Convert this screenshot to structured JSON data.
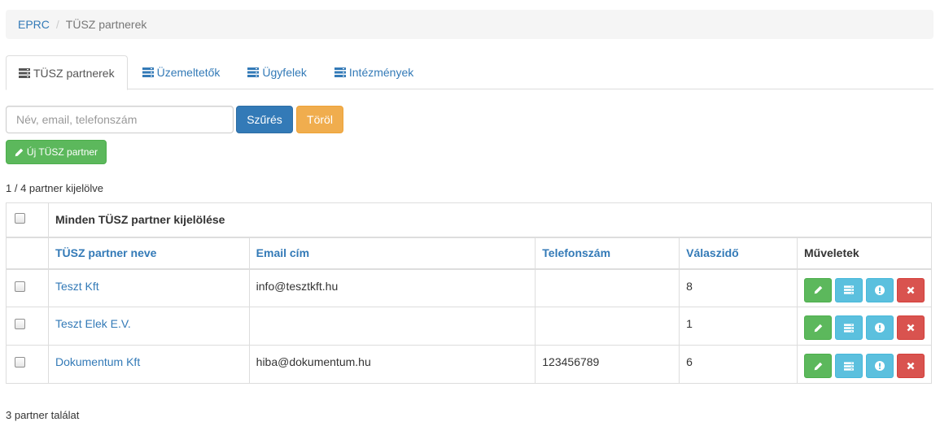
{
  "breadcrumb": {
    "root": "EPRC",
    "separator": "/",
    "current": "TÜSZ partnerek"
  },
  "tabs": [
    {
      "label": "TÜSZ partnerek",
      "icon": "list-icon",
      "active": true
    },
    {
      "label": "Üzemeltetők",
      "icon": "list-icon",
      "active": false
    },
    {
      "label": "Ügyfelek",
      "icon": "list-icon",
      "active": false
    },
    {
      "label": "Intézmények",
      "icon": "list-icon",
      "active": false
    }
  ],
  "filter": {
    "search_placeholder": "Név, email, telefonszám",
    "search_value": "",
    "filter_label": "Szűrés",
    "clear_label": "Töröl"
  },
  "new_button_label": "Új TÜSZ partner",
  "selected_count_text": "1 / 4 partner kijelölve",
  "select_all_label": "Minden TÜSZ partner kijelölése",
  "columns": {
    "name": "TÜSZ partner neve",
    "email": "Email cím",
    "phone": "Telefonszám",
    "response": "Válaszidő",
    "actions": "Műveletek"
  },
  "rows": [
    {
      "name": "Teszt Kft",
      "email": "info@tesztkft.hu",
      "phone": "",
      "response": "8"
    },
    {
      "name": "Teszt Elek E.V.",
      "email": "",
      "phone": "",
      "response": "1"
    },
    {
      "name": "Dokumentum Kft",
      "email": "hiba@dokumentum.hu",
      "phone": "123456789",
      "response": "6"
    }
  ],
  "results_count_text": "3 partner találat",
  "colors": {
    "primary": "#337ab7",
    "warning": "#f0ad4e",
    "success": "#5cb85c",
    "info": "#5bc0de",
    "danger": "#d9534f"
  }
}
